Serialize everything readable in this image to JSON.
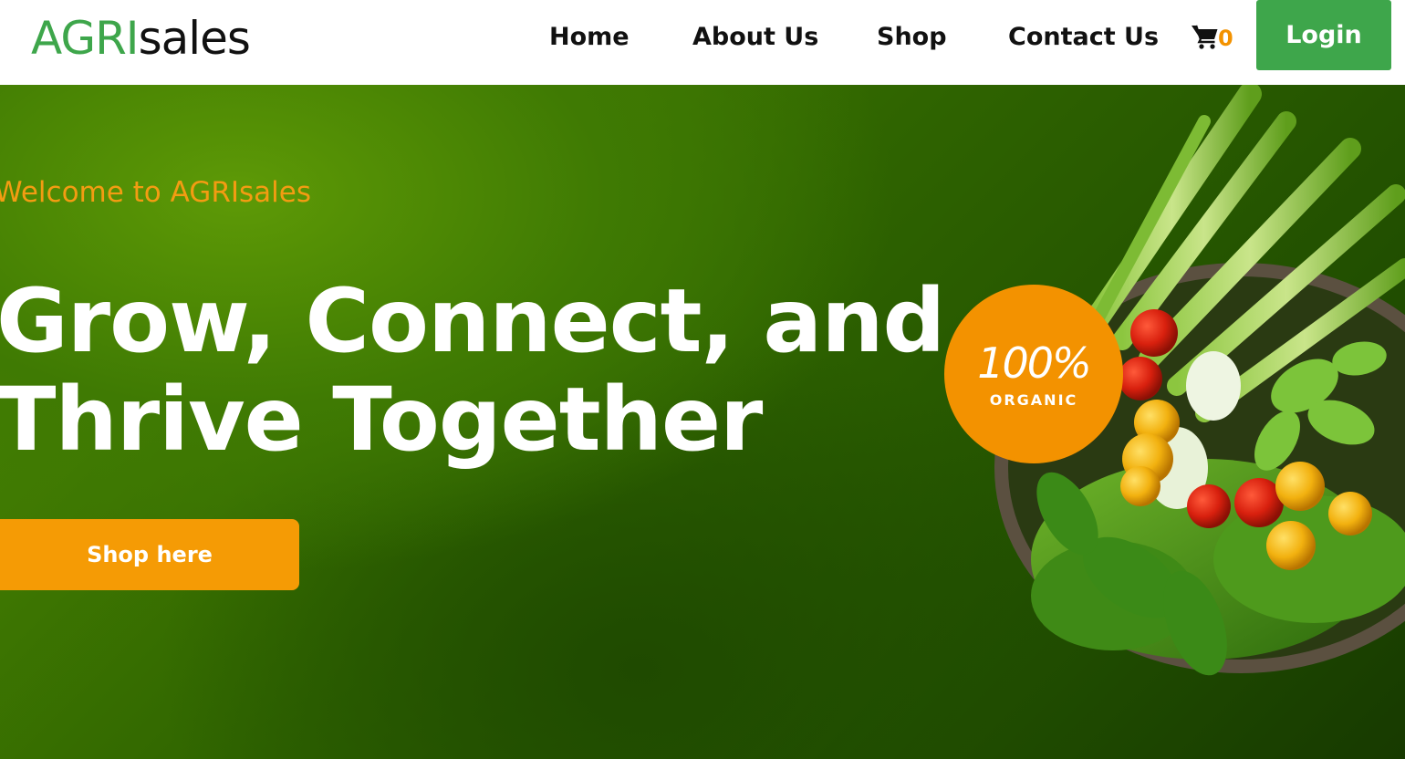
{
  "header": {
    "logo_brand": "AGRI",
    "logo_rest": "sales",
    "nav": {
      "home": "Home",
      "about": "About Us",
      "shop": "Shop",
      "contact": "Contact Us"
    },
    "cart_icon": "cart-icon",
    "cart_count": "0",
    "login_label": "Login"
  },
  "hero": {
    "welcome": "Welcome to AGRIsales",
    "headline_line1": "Grow, Connect, and",
    "headline_line2": "Thrive Together",
    "cta_label": "Shop here",
    "badge_percent": "100%",
    "badge_label": "ORGANIC"
  },
  "colors": {
    "brand_green": "#3ea64b",
    "accent_orange": "#f39200",
    "hero_green": "#3f7a03"
  }
}
